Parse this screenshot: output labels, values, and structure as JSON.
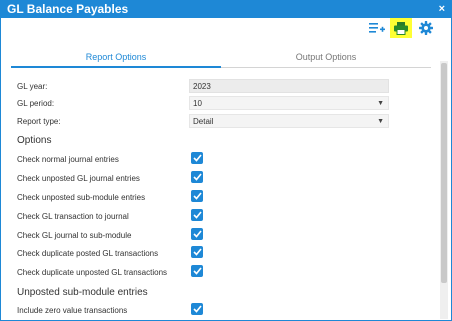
{
  "window": {
    "title": "GL Balance Payables",
    "close_glyph": "×"
  },
  "toolbar": {
    "icons": [
      "list-add-icon",
      "print-icon",
      "gear-icon"
    ],
    "print_highlight_color": "#ffff33",
    "accent_color": "#1e88d6"
  },
  "tabs": [
    {
      "label": "Report Options",
      "active": true
    },
    {
      "label": "Output Options",
      "active": false
    }
  ],
  "fields": {
    "gl_year": {
      "label": "GL year:",
      "value": "2023"
    },
    "gl_period": {
      "label": "GL period:",
      "value": "10"
    },
    "report_type": {
      "label": "Report type:",
      "value": "Detail"
    }
  },
  "sections": {
    "options": "Options",
    "unposted": "Unposted sub-module entries"
  },
  "options": [
    {
      "label": "Check normal journal entries",
      "checked": true
    },
    {
      "label": "Check unposted GL journal entries",
      "checked": true
    },
    {
      "label": "Check unposted sub-module entries",
      "checked": true
    },
    {
      "label": "Check GL transaction to journal",
      "checked": true
    },
    {
      "label": "Check GL journal to sub-module",
      "checked": true
    },
    {
      "label": "Check duplicate posted GL transactions",
      "checked": true
    },
    {
      "label": "Check duplicate unposted GL transactions",
      "checked": true
    }
  ],
  "unposted_options": [
    {
      "label": "Include zero value transactions",
      "checked": true
    }
  ]
}
